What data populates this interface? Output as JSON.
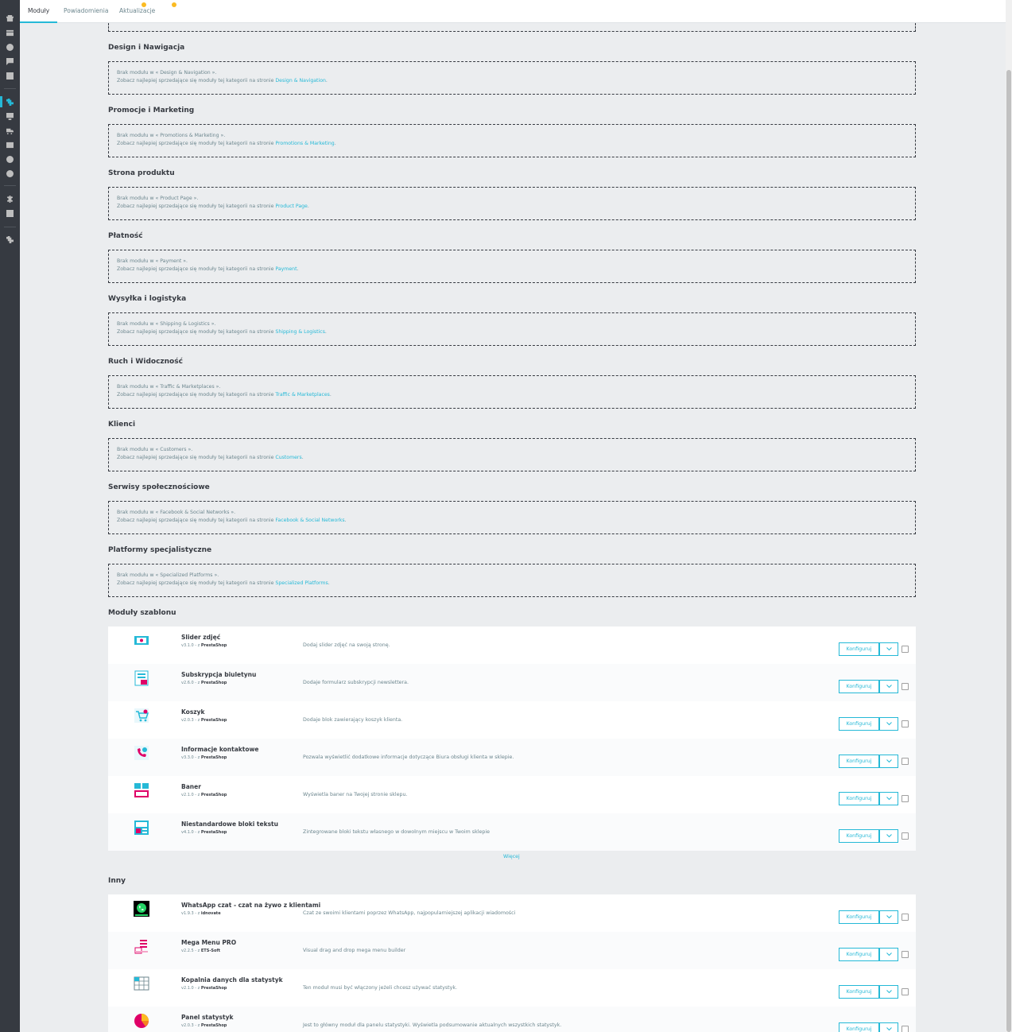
{
  "tabs": [
    {
      "label": "Moduły",
      "active": true
    },
    {
      "label": "Powiadomienia",
      "badge": true
    },
    {
      "label": "Aktualizacje",
      "badge": true
    }
  ],
  "sidebar_icons": [
    "store-icon",
    "orders-icon",
    "customers-icon",
    "messages-icon",
    "stats-icon",
    "modules-icon",
    "design-icon",
    "shipping-icon",
    "payment-icon",
    "international-icon",
    "marketing-icon",
    "settings-icon",
    "advanced-icon",
    "extension-icon"
  ],
  "empty_prefix": "Brak modułu w « ",
  "empty_suffix": " ».",
  "see_best_prefix": "Zobacz najlepiej sprzedające się moduły tej kategorii na stronie ",
  "categories": [
    {
      "title": "Design i Nawigacja",
      "name": "Design & Navigation"
    },
    {
      "title": "Promocje i Marketing",
      "name": "Promotions & Marketing"
    },
    {
      "title": "Strona produktu",
      "name": "Product Page"
    },
    {
      "title": "Płatność",
      "name": "Payment"
    },
    {
      "title": "Wysyłka i logistyka",
      "name": "Shipping & Logistics"
    },
    {
      "title": "Ruch i Widoczność",
      "name": "Traffic & Marketplaces"
    },
    {
      "title": "Klienci",
      "name": "Customers"
    },
    {
      "title": "Serwisy społecznościowe",
      "name": "Facebook & Social Networks"
    },
    {
      "title": "Platformy specjalistyczne",
      "name": "Specialized Platforms"
    }
  ],
  "theme_modules": {
    "title": "Moduły szablonu",
    "more": "Więcej",
    "items": [
      {
        "name": "Slider zdjęć",
        "version": "v3.1.0 - z ",
        "author": "PrestaShop",
        "desc": "Dodaj slider zdjęć na swoją stronę.",
        "icon": "slider-icon"
      },
      {
        "name": "Subskrypcja biuletynu",
        "version": "v2.6.0 - z ",
        "author": "PrestaShop",
        "desc": "Dodaje formularz subskrypcji newslettera.",
        "icon": "newsletter-icon"
      },
      {
        "name": "Koszyk",
        "version": "v2.0.3 - z ",
        "author": "PrestaShop",
        "desc": "Dodaje blok zawierający koszyk klienta.",
        "icon": "cart-icon"
      },
      {
        "name": "Informacje kontaktowe",
        "version": "v3.3.0 - z ",
        "author": "PrestaShop",
        "desc": "Pozwala wyświetlić dodatkowe informacje dotyczące Biura obsługi klienta w sklepie.",
        "icon": "contact-icon"
      },
      {
        "name": "Baner",
        "version": "v2.1.0 - z ",
        "author": "PrestaShop",
        "desc": "Wyświetla baner na Twojej stronie sklepu.",
        "icon": "banner-icon"
      },
      {
        "name": "Niestandardowe bloki tekstu",
        "version": "v4.1.0 - z ",
        "author": "PrestaShop",
        "desc": "Zintegrowane bloki tekstu własnego w dowolnym miejscu w Twoim sklepie",
        "icon": "text-block-icon"
      }
    ]
  },
  "other_modules": {
    "title": "Inny",
    "items": [
      {
        "name": "WhatsApp czat - czat na żywo z klientami",
        "version": "v1.9.3 - z ",
        "author": "idnovate",
        "desc": "Czat ze swoimi klientami poprzez WhatsApp, najpopularniejszej aplikacji wiadomości",
        "icon": "whatsapp-icon"
      },
      {
        "name": "Mega Menu PRO",
        "version": "v2.2.5 - z ",
        "author": "ETS-Soft",
        "desc": "Visual drag and drop mega menu builder",
        "icon": "mega-menu-icon"
      },
      {
        "name": "Kopalnia danych dla statystyk",
        "version": "v2.1.0 - z ",
        "author": "PrestaShop",
        "desc": "Ten moduł musi być włączony jeżeli chcesz używać statystyk.",
        "icon": "data-mining-icon"
      },
      {
        "name": "Panel statystyk",
        "version": "v2.0.3 - z ",
        "author": "PrestaShop",
        "desc": "Jest to główny moduł dla panelu statystyki. Wyświetla podsumowanie aktualnych wszystkich statystyk.",
        "icon": "stats-panel-icon"
      }
    ]
  },
  "configure_label": "Konfiguruj",
  "colors": {
    "accent": "#25b9d7",
    "sidebar": "#363a41",
    "badge": "#fbbb22",
    "logo_pink": "#df0067"
  }
}
